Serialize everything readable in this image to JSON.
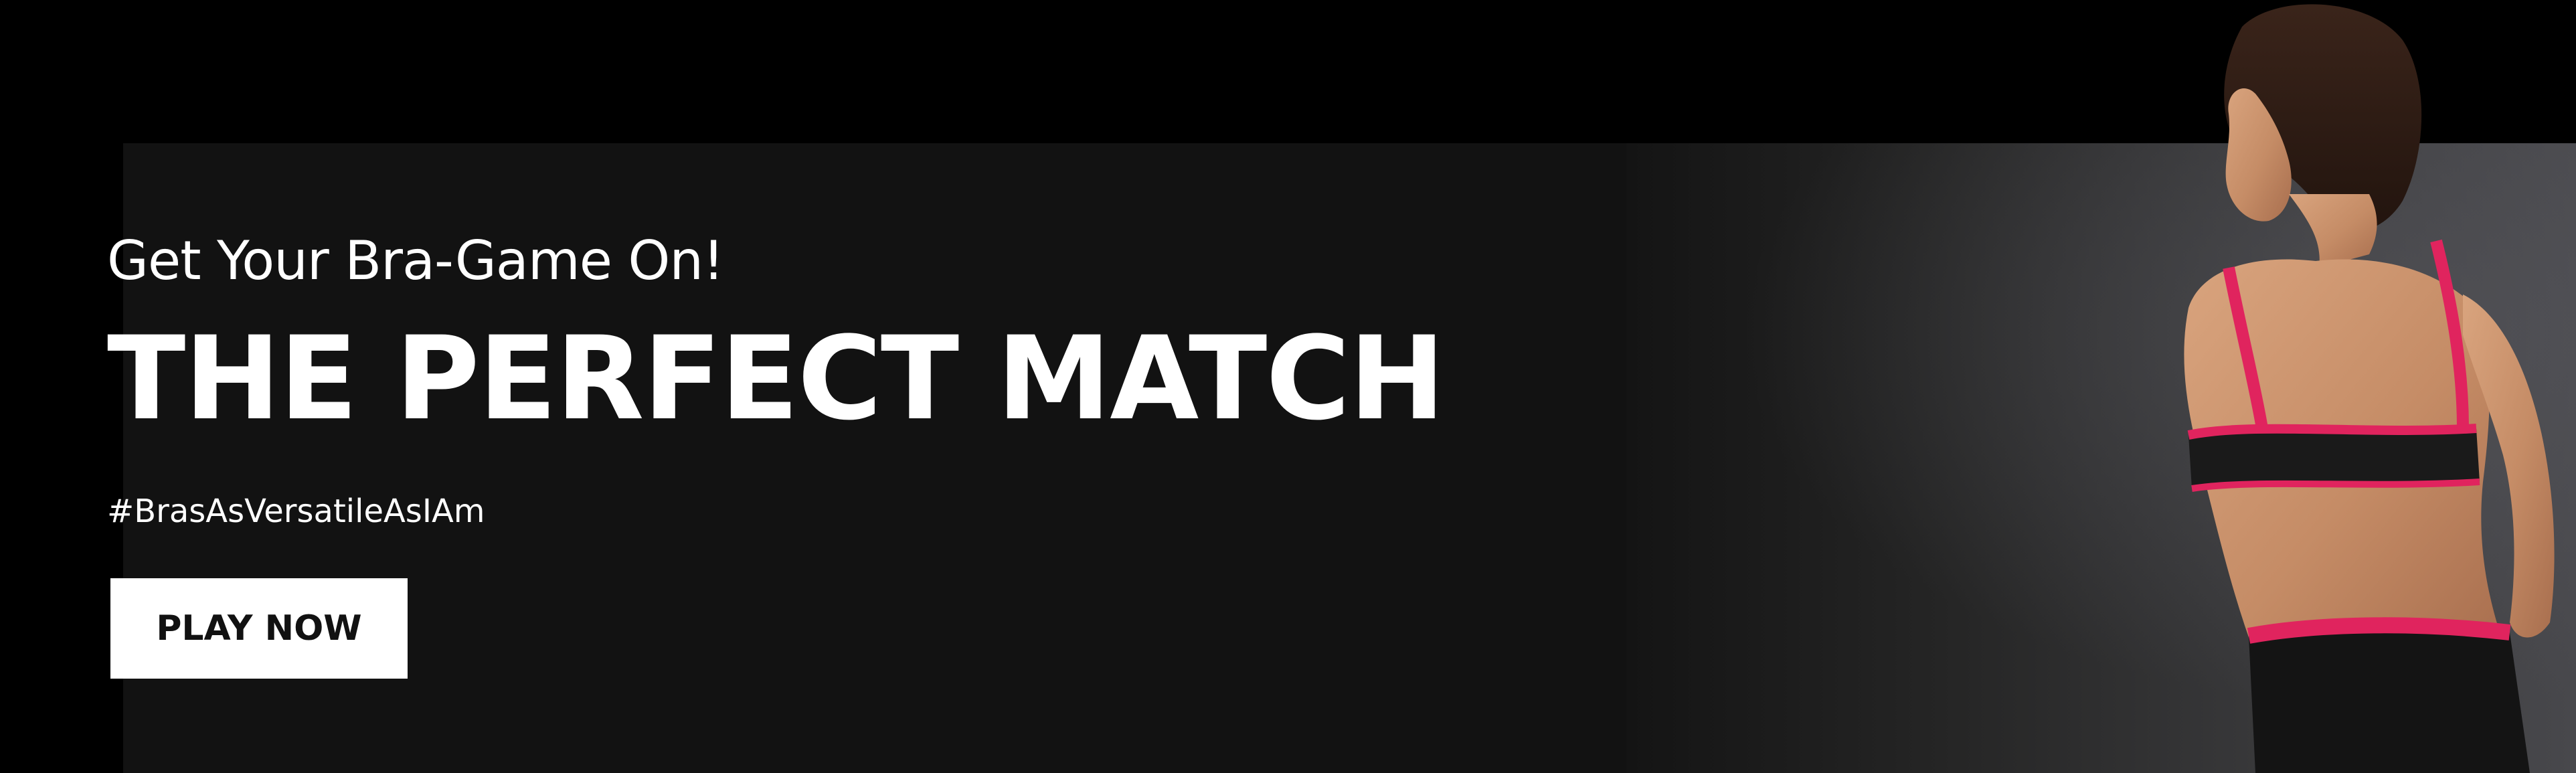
{
  "banner": {
    "eyebrow": "Get Your Bra-Game On!",
    "headline": "THE PERFECT MATCH",
    "hashtag": "#BrasAsVersatileAsIAm",
    "cta_label": "PLAY NOW"
  },
  "colors": {
    "background": "#000000",
    "panel": "#121212",
    "text": "#ffffff",
    "cta_background": "#ffffff",
    "cta_text": "#111111",
    "accent": "#e0245e"
  },
  "image": {
    "name": "model-photo"
  }
}
